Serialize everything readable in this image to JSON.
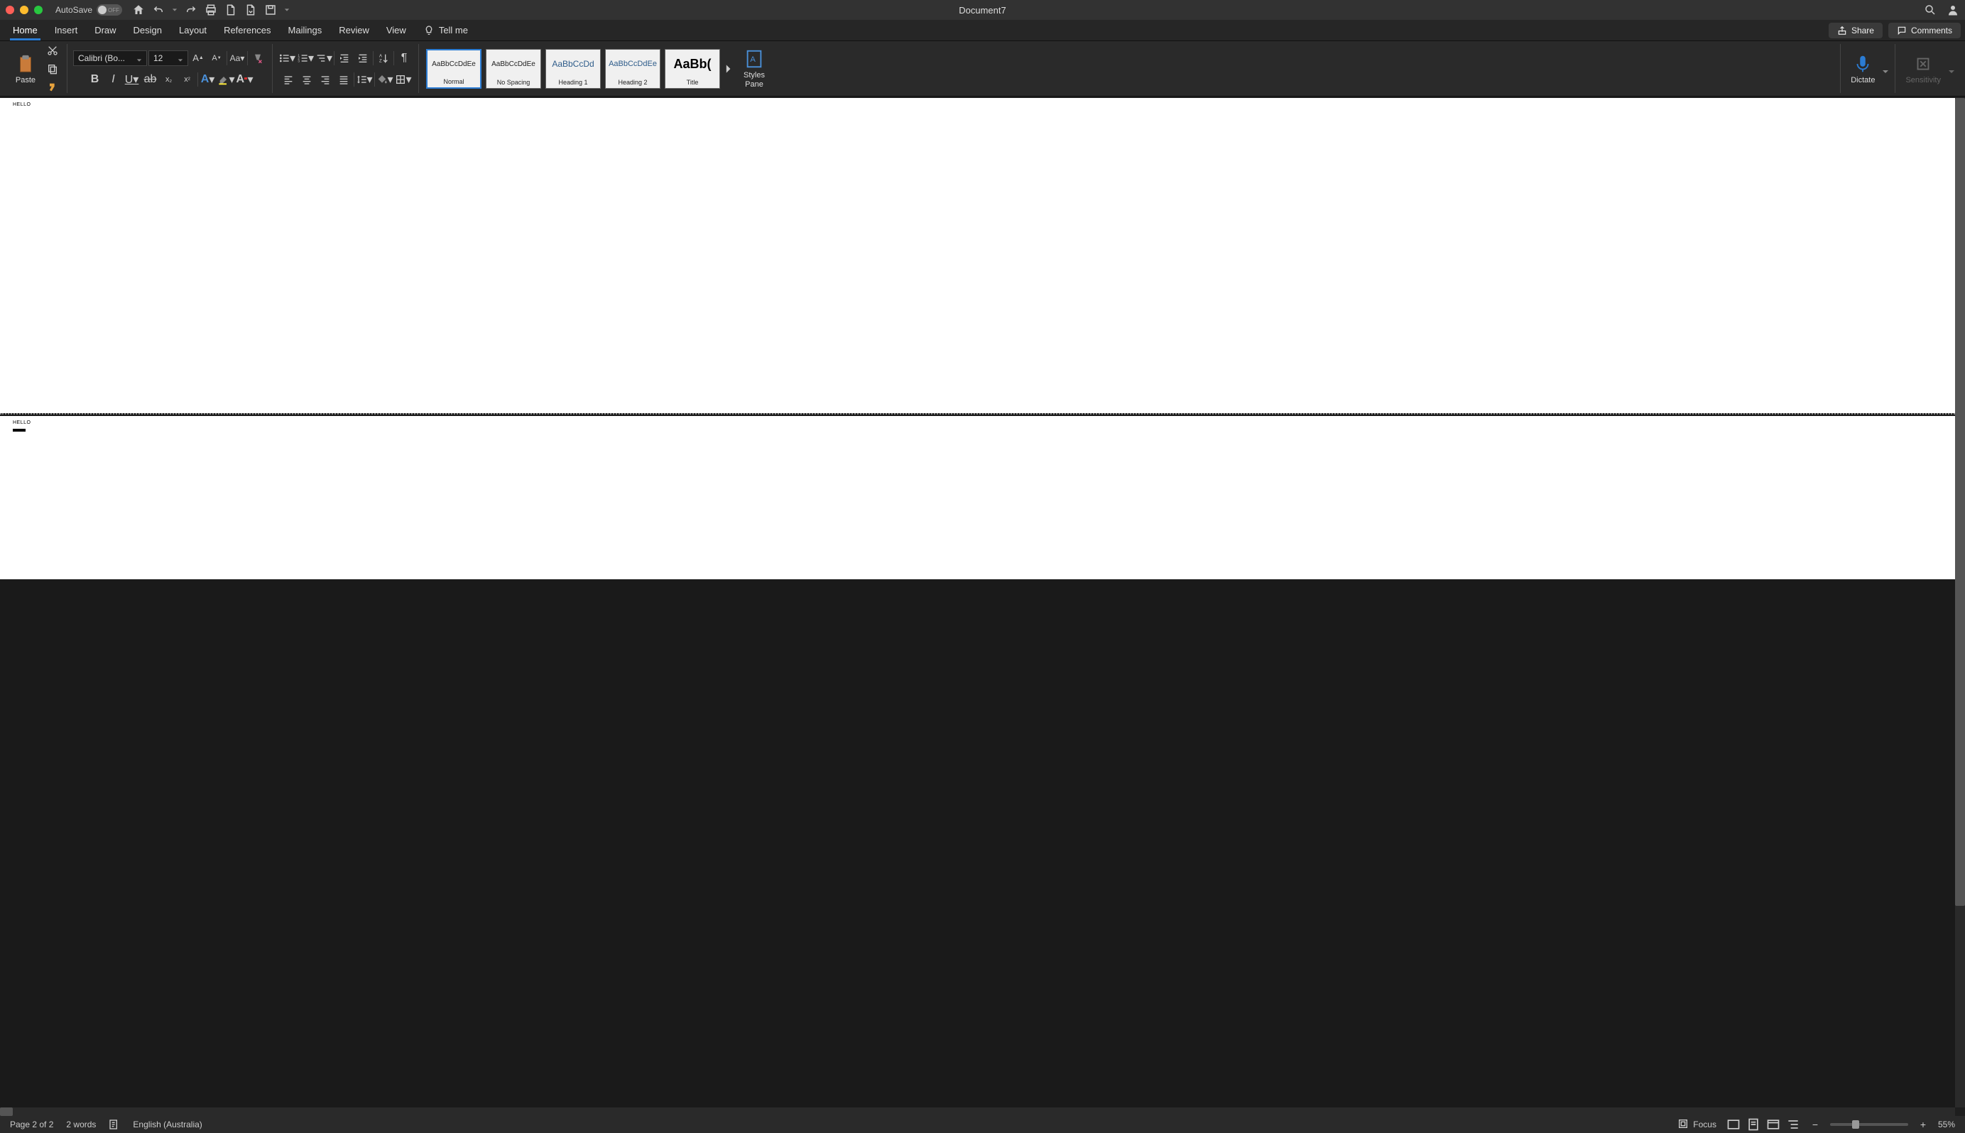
{
  "titlebar": {
    "autosave_label": "AutoSave",
    "autosave_state": "OFF",
    "document_title": "Document7"
  },
  "tabs": {
    "items": [
      {
        "label": "Home",
        "active": true
      },
      {
        "label": "Insert",
        "active": false
      },
      {
        "label": "Draw",
        "active": false
      },
      {
        "label": "Design",
        "active": false
      },
      {
        "label": "Layout",
        "active": false
      },
      {
        "label": "References",
        "active": false
      },
      {
        "label": "Mailings",
        "active": false
      },
      {
        "label": "Review",
        "active": false
      },
      {
        "label": "View",
        "active": false
      }
    ],
    "tellme_label": "Tell me",
    "share_label": "Share",
    "comments_label": "Comments"
  },
  "ribbon": {
    "paste_label": "Paste",
    "font_name": "Calibri (Bo...",
    "font_size": "12",
    "styles": [
      {
        "preview": "AaBbCcDdEe",
        "label": "Normal",
        "selected": true,
        "cls": ""
      },
      {
        "preview": "AaBbCcDdEe",
        "label": "No Spacing",
        "selected": false,
        "cls": ""
      },
      {
        "preview": "AaBbCcDd",
        "label": "Heading 1",
        "selected": false,
        "cls": "h1"
      },
      {
        "preview": "AaBbCcDdEe",
        "label": "Heading 2",
        "selected": false,
        "cls": "h2"
      },
      {
        "preview": "AaBb(",
        "label": "Title",
        "selected": false,
        "cls": "title"
      }
    ],
    "styles_pane_label": "Styles\nPane",
    "dictate_label": "Dictate",
    "sensitivity_label": "Sensitivity"
  },
  "document": {
    "page1_text": "HELLO",
    "page2_text": "HELLO"
  },
  "statusbar": {
    "page_info": "Page 2 of 2",
    "word_count": "2 words",
    "language": "English (Australia)",
    "focus_label": "Focus",
    "zoom_value": "55%"
  }
}
